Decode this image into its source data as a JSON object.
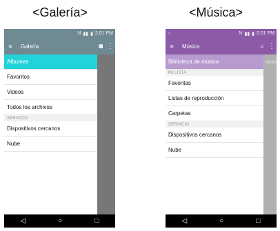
{
  "captions": {
    "left": "<Galería>",
    "right": "<Música>"
  },
  "gallery": {
    "status_text": "2:01 PM",
    "app_title": "Galería",
    "items": [
      {
        "label": "Albumes"
      },
      {
        "label": "Favoritos"
      },
      {
        "label": "Videos"
      },
      {
        "label": "Todos los archivos"
      }
    ],
    "section_service": "SERVICIO",
    "service_items": [
      {
        "label": "Dispositivos cercanos"
      },
      {
        "label": "Nube"
      }
    ],
    "icons": [
      "menu-icon",
      "camera-icon",
      "overflow-icon"
    ]
  },
  "music": {
    "status_text": "2:01 PM",
    "app_title": "Música",
    "header_item": "Biblioteca de música",
    "peek_text": "rtistas",
    "section_list": "MI LISTA",
    "list_items": [
      {
        "label": "Favoritas"
      },
      {
        "label": "Listas de reproducción"
      },
      {
        "label": "Carpetas"
      }
    ],
    "section_service": "SERVICIO",
    "service_items": [
      {
        "label": "Dispositivos cercanos"
      },
      {
        "label": "Nube"
      }
    ],
    "icons": [
      "menu-icon",
      "search-icon",
      "overflow-icon"
    ]
  },
  "navbar": {
    "back": "◁",
    "home": "○",
    "recent": "□"
  },
  "colors": {
    "gallery_bar": "#6f8a93",
    "gallery_accent": "#23d3da",
    "music_bar": "#8c5aa6",
    "music_accent": "#b79ad0"
  }
}
